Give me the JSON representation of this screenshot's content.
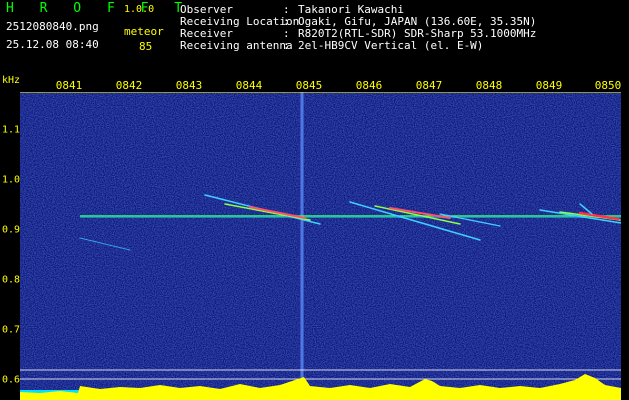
{
  "header": {
    "app_title": "H R O F F T",
    "app_version": "1.0.0",
    "filename": "2512080840.png",
    "datetime": "25.12.08 08:40",
    "meteor_label": "meteor",
    "meteor_count": "85"
  },
  "info": {
    "rows": [
      {
        "label": "Observer",
        "value": "Takanori Kawachi"
      },
      {
        "label": "Receiving Location",
        "value": "Ogaki, Gifu, JAPAN (136.60E, 35.35N)"
      },
      {
        "label": "Receiver",
        "value": "R820T2(RTL-SDR) SDR-Sharp 53.1000MHz"
      },
      {
        "label": "Receiving antenna",
        "value": "2el-HB9CV Vertical (el. E-W)"
      }
    ],
    "separator": ":"
  },
  "axis": {
    "y_unit": "kHz",
    "x_ticks": [
      "0841",
      "0842",
      "0843",
      "0844",
      "0845",
      "0846",
      "0847",
      "0848",
      "0849",
      "0850"
    ],
    "y_ticks": [
      "1.1",
      "1.0",
      "0.9",
      "0.8",
      "0.7",
      "0.6"
    ]
  },
  "colors": {
    "background": "#000000",
    "label": "#ffff00",
    "title": "#00ff00",
    "spectrum_base": "#0a1470",
    "carrier": "#33ff66",
    "power_fill": "#ffff00",
    "power_base": "#00e0ff"
  }
}
